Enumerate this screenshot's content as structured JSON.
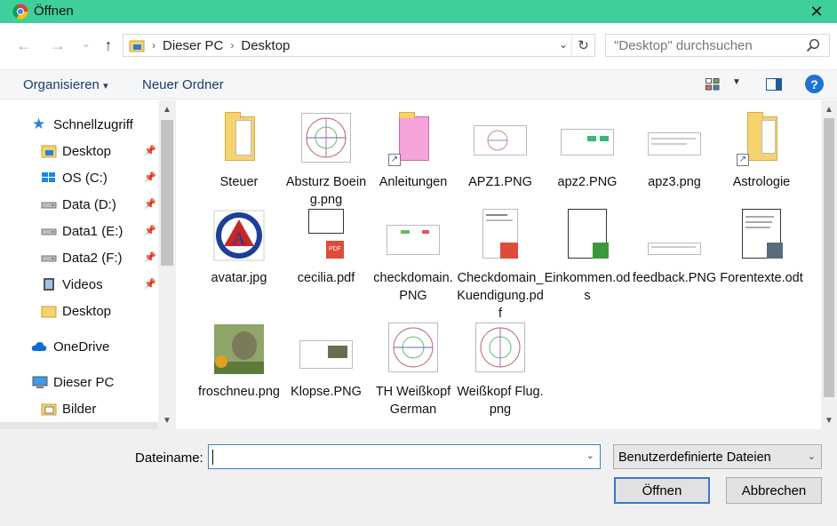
{
  "window": {
    "title": "Öffnen",
    "close_glyph": "✕"
  },
  "nav": {
    "back_glyph": "←",
    "forward_glyph": "→",
    "dropdown_glyph": "⌄",
    "up_glyph": "↑",
    "breadcrumb": [
      "Dieser PC",
      "Desktop"
    ],
    "refresh_glyph": "↻",
    "search_placeholder": "\"Desktop\" durchsuchen"
  },
  "toolbar": {
    "organize": "Organisieren",
    "organize_arrow": "▾",
    "new_folder": "Neuer Ordner",
    "help": "?"
  },
  "sidebar": {
    "items": [
      {
        "label": "Schnellzugriff",
        "icon": "star-icon",
        "pinned": false
      },
      {
        "label": "Desktop",
        "icon": "desktop-folder-icon",
        "pinned": true
      },
      {
        "label": "OS (C:)",
        "icon": "windows-drive-icon",
        "pinned": true
      },
      {
        "label": "Data (D:)",
        "icon": "drive-icon",
        "pinned": true
      },
      {
        "label": "Data1 (E:)",
        "icon": "drive-icon",
        "pinned": true
      },
      {
        "label": "Data2 (F:)",
        "icon": "drive-icon",
        "pinned": true
      },
      {
        "label": "Videos",
        "icon": "video-icon",
        "pinned": true
      },
      {
        "label": "Desktop",
        "icon": "folder-icon",
        "pinned": false
      },
      {
        "label": "OneDrive",
        "icon": "cloud-icon",
        "pinned": false
      },
      {
        "label": "Dieser PC",
        "icon": "pc-icon",
        "pinned": false
      },
      {
        "label": "Bilder",
        "icon": "pictures-folder-icon",
        "pinned": false
      }
    ],
    "pin_glyph": "📌"
  },
  "files": [
    {
      "label": "Steuer",
      "icon": "folder-icon"
    },
    {
      "label": "Absturz Boeing.png",
      "icon": "chart-image-icon"
    },
    {
      "label": "Anleitungen",
      "icon": "folder-shortcut-icon"
    },
    {
      "label": "APZ1.PNG",
      "icon": "screenshot-icon"
    },
    {
      "label": "apz2.PNG",
      "icon": "screenshot-icon"
    },
    {
      "label": "apz3.png",
      "icon": "screenshot-icon"
    },
    {
      "label": "Astrologie",
      "icon": "folder-shortcut-icon"
    },
    {
      "label": "avatar.jpg",
      "icon": "avatar-image-icon"
    },
    {
      "label": "cecilia.pdf",
      "icon": "pdf-icon"
    },
    {
      "label": "checkdomain.PNG",
      "icon": "screenshot-icon"
    },
    {
      "label": "Checkdomain_Kuendigung.pdf",
      "icon": "pdf-icon"
    },
    {
      "label": "Einkommen.ods",
      "icon": "spreadsheet-icon"
    },
    {
      "label": "feedback.PNG",
      "icon": "screenshot-icon"
    },
    {
      "label": "Forentexte.odt",
      "icon": "text-document-icon"
    },
    {
      "label": "froschneu.png",
      "icon": "frog-image-icon"
    },
    {
      "label": "Klopse.PNG",
      "icon": "screenshot-icon"
    },
    {
      "label": "TH Weißkopf German",
      "icon": "chart-image-icon"
    },
    {
      "label": "Weißkopf Flug.png",
      "icon": "chart-image-icon"
    }
  ],
  "bottom": {
    "filename_label": "Dateiname:",
    "filename_value": "",
    "filetype": "Benutzerdefinierte Dateien",
    "open_button": "Öffnen",
    "cancel_button": "Abbrechen"
  },
  "colors": {
    "titlebar": "#3fcf9a",
    "link_text": "#1e3b6e",
    "help_blue": "#1d73d1"
  }
}
